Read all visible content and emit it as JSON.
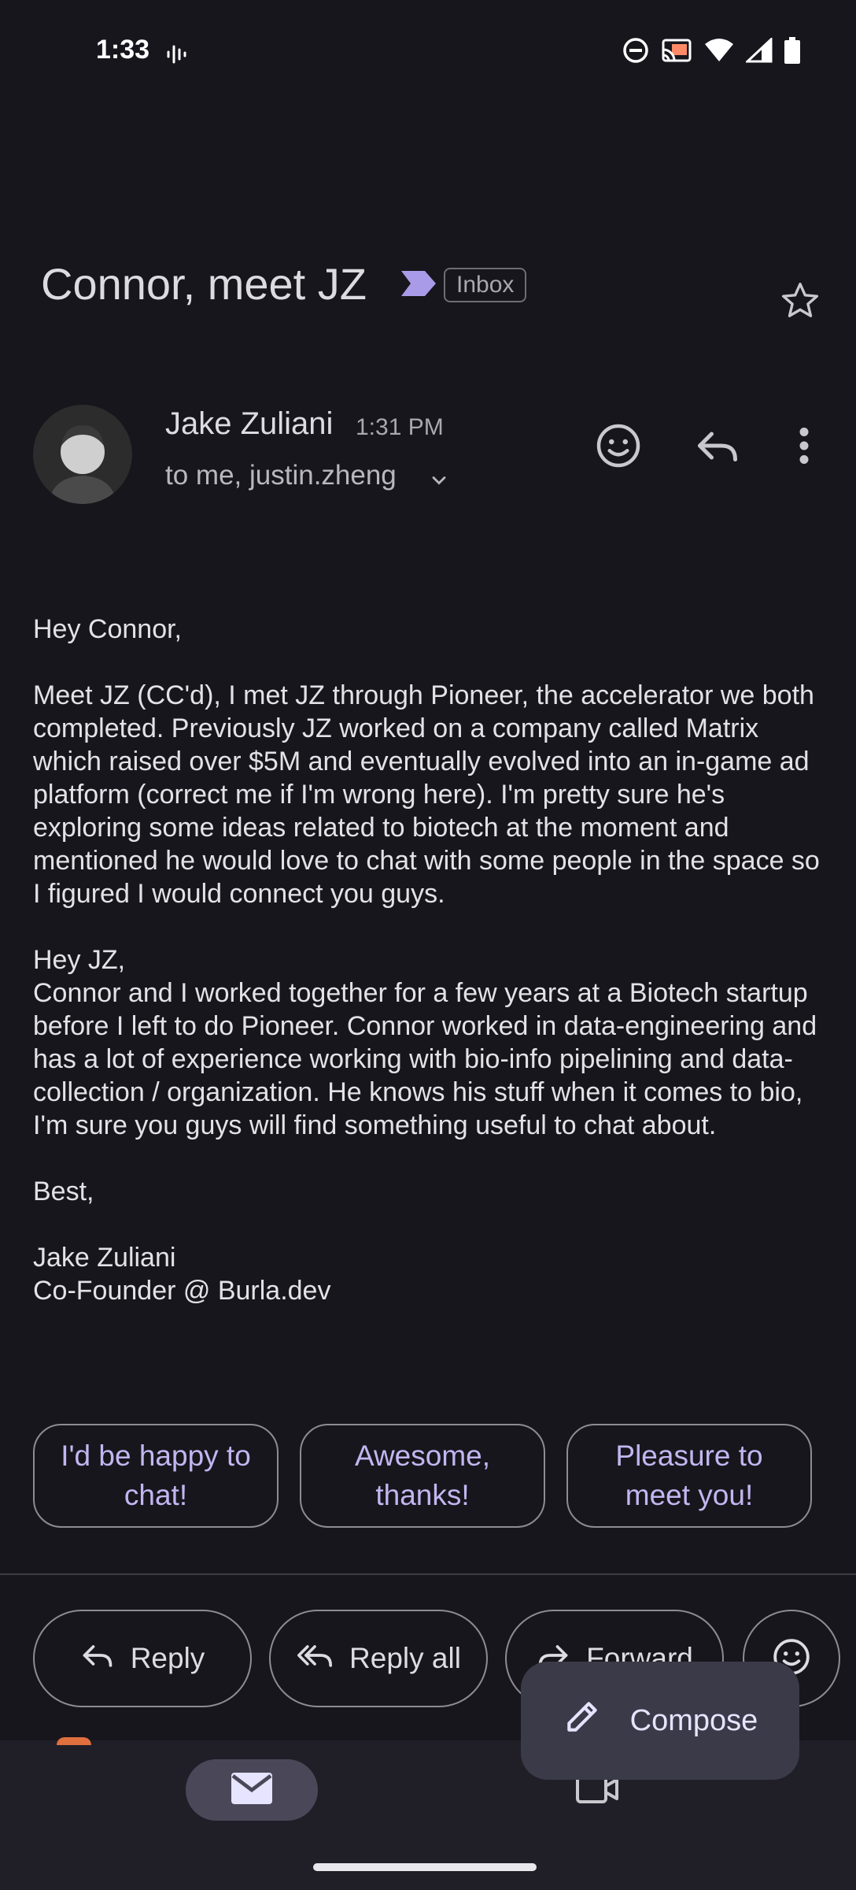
{
  "status_bar": {
    "time": "1:33"
  },
  "email": {
    "subject": "Connor, meet JZ",
    "label": "Inbox",
    "sender_name": "Jake Zuliani",
    "time": "1:31 PM",
    "recipients": "to me, justin.zheng",
    "body": "Hey Connor,\n\nMeet JZ (CC'd), I met JZ through Pioneer, the accelerator we both completed. Previously JZ worked on a company called Matrix which raised over $5M and eventually evolved into an in-game ad platform (correct me if I'm wrong here). I'm pretty sure he's exploring some ideas related to biotech at the moment and mentioned he would love to chat with some people in the space so I figured I would connect you guys.\n\nHey JZ,\nConnor and I worked together for a few years at a Biotech startup before I left to do Pioneer. Connor worked in data-engineering and has a lot of experience working with bio-info pipelining and data-collection / organization. He knows his stuff when it comes to bio, I'm sure you guys will find something useful to chat about.\n\nBest,\n\nJake Zuliani\nCo-Founder @ Burla.dev"
  },
  "smart_replies": [
    "I'd be happy to chat!",
    "Awesome, thanks!",
    "Pleasure to meet you!"
  ],
  "actions": {
    "reply": "Reply",
    "reply_all": "Reply all",
    "forward": "Forward"
  },
  "compose": {
    "label": "Compose"
  },
  "icons": {
    "label_arrow": "label-arrow-icon",
    "star": "star-icon",
    "emoji": "emoji-icon",
    "reply": "reply-icon",
    "more": "more-vert-icon",
    "mail": "mail-icon",
    "video": "video-icon"
  },
  "colors": {
    "accent": "#c2b6f1",
    "background": "#17161c",
    "compose_bg": "#3b3a48"
  }
}
